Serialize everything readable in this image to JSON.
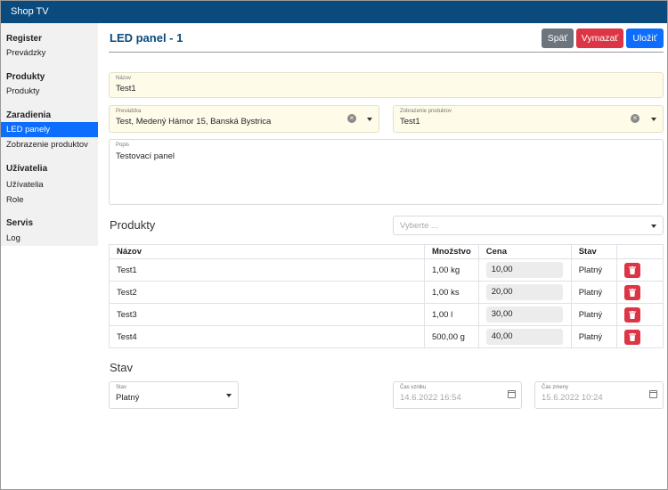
{
  "app": {
    "title": "Shop TV"
  },
  "sidebar": {
    "groups": [
      {
        "header": "Register",
        "items": [
          {
            "label": "Prevádzky"
          }
        ]
      },
      {
        "header": "Produkty",
        "items": [
          {
            "label": "Produkty"
          }
        ]
      },
      {
        "header": "Zaradienia",
        "items": [
          {
            "label": "LED panely",
            "active": true
          },
          {
            "label": "Zobrazenie produktov"
          }
        ]
      },
      {
        "header": "Užívatelia",
        "items": [
          {
            "label": "Užívatelia"
          },
          {
            "label": "Role"
          }
        ]
      },
      {
        "header": "Servis",
        "items": [
          {
            "label": "Log"
          }
        ]
      }
    ]
  },
  "page": {
    "title": "LED panel - 1",
    "buttons": {
      "back": "Späť",
      "delete": "Vymazať",
      "save": "Uložiť"
    }
  },
  "form": {
    "name": {
      "label": "Názov",
      "value": "Test1"
    },
    "store": {
      "label": "Prevádzka",
      "value": "Test, Medený Hámor 15, Banská Bystrica"
    },
    "product_display": {
      "label": "Zobrazenie produktov",
      "value": "Test1"
    },
    "description": {
      "label": "Popis",
      "value": "Testovací panel"
    }
  },
  "products": {
    "title": "Produkty",
    "select_placeholder": "Vyberte ...",
    "columns": {
      "name": "Názov",
      "quantity": "Množstvo",
      "price": "Cena",
      "status": "Stav"
    },
    "rows": [
      {
        "name": "Test1",
        "quantity": "1,00 kg",
        "price": "10,00",
        "status": "Platný"
      },
      {
        "name": "Test2",
        "quantity": "1,00 ks",
        "price": "20,00",
        "status": "Platný"
      },
      {
        "name": "Test3",
        "quantity": "1,00 l",
        "price": "30,00",
        "status": "Platný"
      },
      {
        "name": "Test4",
        "quantity": "500,00 g",
        "price": "40,00",
        "status": "Platný"
      }
    ]
  },
  "status_section": {
    "title": "Stav",
    "status": {
      "label": "Stav",
      "value": "Platný"
    },
    "created": {
      "label": "Čas vzniku",
      "value": "14.6.2022 16:54"
    },
    "modified": {
      "label": "Čas zmeny",
      "value": "15.6.2022 10:24"
    }
  },
  "colors": {
    "topbar": "#0a4a7c",
    "active_nav": "#0d6efd",
    "danger": "#dc3545",
    "secondary": "#6c757d",
    "primary": "#0d6efd",
    "required_field": "#fefbe8"
  }
}
